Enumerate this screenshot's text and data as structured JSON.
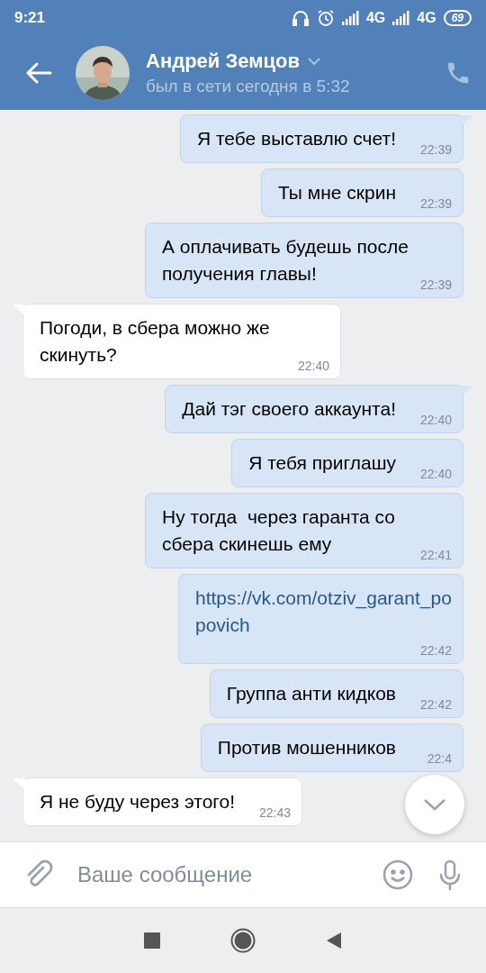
{
  "status_bar": {
    "time": "9:21",
    "network_1": "4G",
    "network_2": "4G",
    "battery": "69"
  },
  "header": {
    "name": "Андрей Земцов",
    "status": "был в сети сегодня в 5:32"
  },
  "messages": [
    {
      "outgoing": true,
      "kind": "text",
      "tail": true,
      "text": "Я тебе выставлю счет!",
      "time": "22:39"
    },
    {
      "outgoing": true,
      "kind": "text",
      "tail": false,
      "text": "Ты мне скрин",
      "time": "22:39"
    },
    {
      "outgoing": true,
      "kind": "text",
      "tail": false,
      "text": "А оплачивать будешь после получения главы!",
      "time": "22:39"
    },
    {
      "outgoing": false,
      "kind": "text",
      "tail": true,
      "text": "Погоди, в сбера можно же скинуть?",
      "time": "22:40"
    },
    {
      "outgoing": true,
      "kind": "text",
      "tail": true,
      "text": "Дай тэг своего аккаунта!",
      "time": "22:40"
    },
    {
      "outgoing": true,
      "kind": "text",
      "tail": false,
      "text": "Я тебя приглашу",
      "time": "22:40"
    },
    {
      "outgoing": true,
      "kind": "text",
      "tail": false,
      "text": "Ну тогда  через гаранта со сбера скинешь ему",
      "time": "22:41"
    },
    {
      "outgoing": true,
      "kind": "link",
      "tail": false,
      "text": "https://vk.com/otziv_garant_popovich",
      "time": "22:42"
    },
    {
      "outgoing": true,
      "kind": "text",
      "tail": false,
      "text": "Группа анти кидков",
      "time": "22:42"
    },
    {
      "outgoing": true,
      "kind": "text",
      "tail": false,
      "text": "Против мошенников",
      "time": "22:4"
    },
    {
      "outgoing": false,
      "kind": "text",
      "tail": true,
      "text": "Я не буду через этого!",
      "time": "22:43"
    }
  ],
  "composer": {
    "placeholder": "Ваше сообщение"
  }
}
